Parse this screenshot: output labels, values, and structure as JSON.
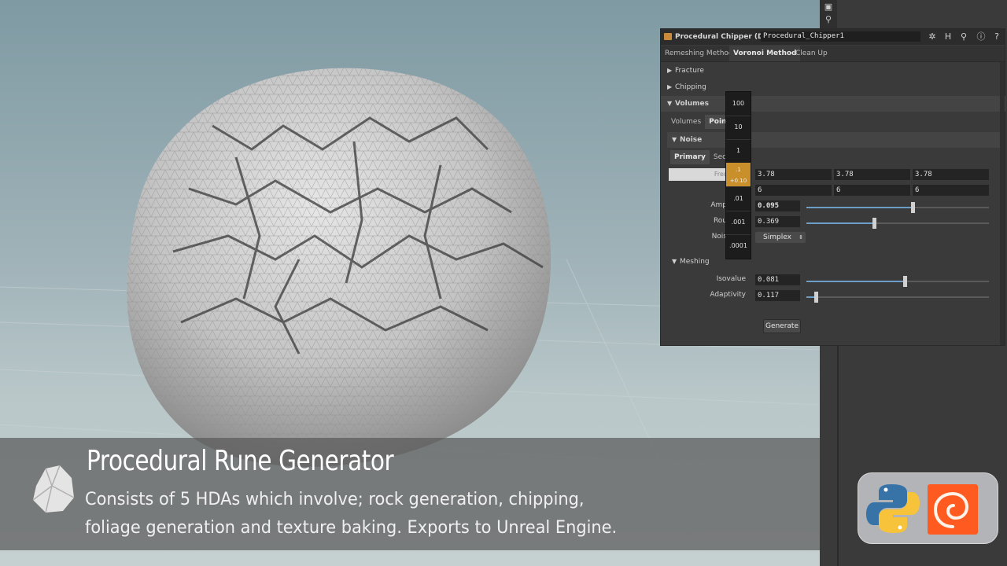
{
  "panel": {
    "node_type": "Procedural Chipper (Dev)",
    "node_name": "Procedural_Chipper1",
    "toolbar_icons": [
      "gear-icon",
      "h-icon",
      "search-icon",
      "info-icon",
      "help-icon"
    ],
    "tabs": [
      "Remeshing Method",
      "Voronoi Method",
      "Clean Up"
    ],
    "active_tab": "Voronoi Method",
    "folders": {
      "fracture": "Fracture",
      "chipping": "Chipping",
      "volumes": "Volumes"
    },
    "volume_subtabs": [
      "Volumes",
      "Point"
    ],
    "noise_label": "Noise",
    "noise_subtabs": [
      "Primary",
      "Seco"
    ],
    "freq_label": "Freq",
    "freq_values": [
      "3.78",
      "3.78",
      "3.78"
    ],
    "offset_values": [
      "6",
      "6",
      "6"
    ],
    "amplitude_label": "Amp",
    "amplitude_value": "0.095",
    "amplitude_level": 0.58,
    "roughness_label": "Rou",
    "roughness_value": "0.369",
    "roughness_level": 0.37,
    "noise_type_label": "Nois",
    "noise_type_value": "Simplex",
    "meshing_label": "Meshing",
    "isovalue_label": "Isovalue",
    "isovalue_value": "0.081",
    "isovalue_level": 0.54,
    "adaptivity_label": "Adaptivity",
    "adaptivity_value": "0.117",
    "adaptivity_level": 0.05,
    "generate_label": "Generate"
  },
  "ladder": {
    "steps": [
      "100",
      "10",
      "1",
      ".1",
      ".01",
      ".001",
      ".0001"
    ],
    "active_step": ".1",
    "active_delta": "+0.10"
  },
  "caption": {
    "title": "Procedural Rune Generator",
    "line1": "Consists of 5 HDAs which involve; rock generation, chipping,",
    "line2": "foliage generation and texture baking. Exports to Unreal Engine."
  },
  "badges": [
    "python-logo",
    "houdini-logo"
  ],
  "colors": {
    "accent_slider": "#6c9ec7",
    "ladder_active": "#c98f2a",
    "houdini_orange": "#ff5a1f"
  }
}
